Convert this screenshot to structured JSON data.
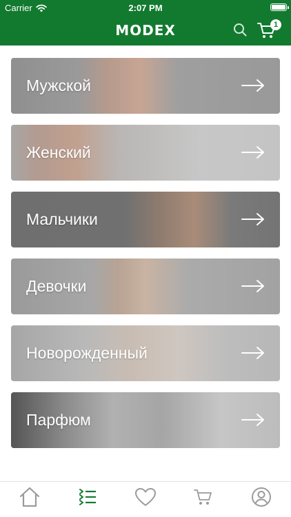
{
  "status_bar": {
    "carrier": "Carrier",
    "time": "2:07 PM"
  },
  "header": {
    "logo": "MODEX",
    "cart_count": "1"
  },
  "categories": [
    {
      "label": "Мужской"
    },
    {
      "label": "Женский"
    },
    {
      "label": "Мальчики"
    },
    {
      "label": "Девочки"
    },
    {
      "label": "Новорожденный"
    },
    {
      "label": "Парфюм"
    }
  ],
  "tab_bar": {
    "tabs": [
      {
        "icon": "home-icon",
        "active": false
      },
      {
        "icon": "catalog-list-icon",
        "active": true
      },
      {
        "icon": "heart-icon",
        "active": false
      },
      {
        "icon": "cart-icon",
        "active": false
      },
      {
        "icon": "profile-icon",
        "active": false
      }
    ]
  },
  "colors": {
    "brand": "#127a2f",
    "inactive_icon": "#9a9a9a"
  }
}
